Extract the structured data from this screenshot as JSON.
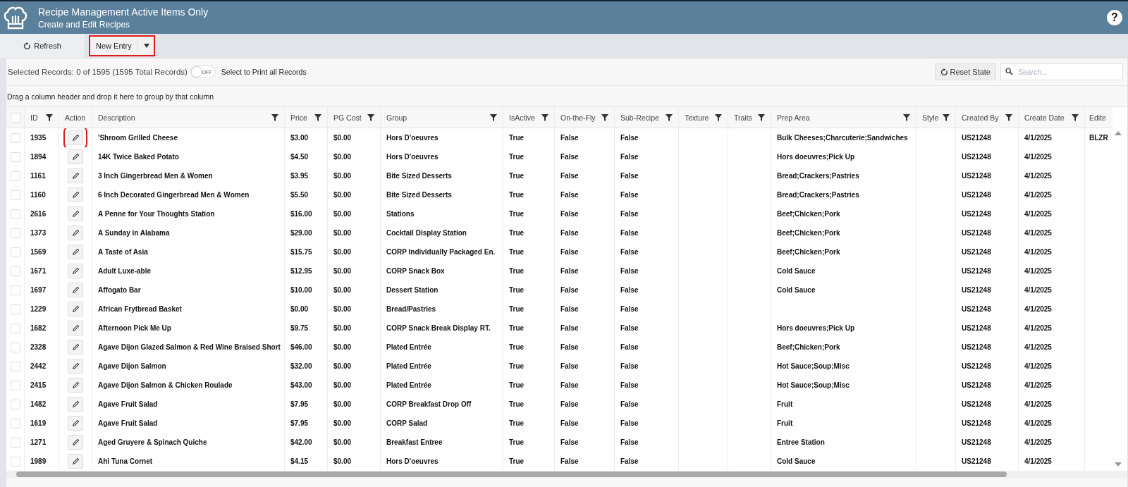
{
  "header": {
    "title": "Recipe Management Active Items Only",
    "subtitle": "Create and Edit Recipes",
    "help": "?"
  },
  "toolbar": {
    "refresh": "Refresh",
    "new_entry": {
      "label": "New Entry",
      "highlighted": true
    }
  },
  "records": {
    "summary": "Selected Records: 0 of 1595 (1595 Total Records)",
    "print_toggle": {
      "on": false,
      "label": "OFF"
    },
    "print_label": "Select to Print all Records",
    "reset": "Reset State",
    "search": {
      "placeholder": "Search..."
    }
  },
  "group_hint": "Drag a column header and drop it here to group by that column",
  "table": {
    "select_all": {
      "checked": false
    },
    "columns": [
      {
        "label": "ID",
        "filter": true
      },
      {
        "label": "Action",
        "filter": false
      },
      {
        "label": "Description",
        "filter": true
      },
      {
        "label": "Price",
        "filter": true
      },
      {
        "label": "PG Cost",
        "filter": true
      },
      {
        "label": "Group",
        "filter": true
      },
      {
        "label": "IsActive",
        "filter": true
      },
      {
        "label": "On-the-Fly",
        "filter": true
      },
      {
        "label": "Sub-Recipe",
        "filter": true
      },
      {
        "label": "Texture",
        "filter": true
      },
      {
        "label": "Traits",
        "filter": true
      },
      {
        "label": "Prep Area",
        "filter": true
      },
      {
        "label": "Style",
        "filter": true
      },
      {
        "label": "Created By",
        "filter": true
      },
      {
        "label": "Create Date",
        "filter": true
      },
      {
        "label": "Edite",
        "filter": false
      }
    ],
    "rows": [
      {
        "checked": false,
        "action_highlighted": true,
        "id": "1935",
        "description": "'Shroom Grilled Cheese",
        "price": "$3.00",
        "pg_cost": "$0.00",
        "group": "Hors D'oeuvres",
        "is_active": "True",
        "on_the_fly": "False",
        "sub_recipe": "False",
        "prep_area": "Bulk Cheeses;Charcuterie;Sandwiches",
        "created_by": "US21248",
        "create_date": "4/1/2025",
        "edited": "BLZR"
      },
      {
        "checked": false,
        "action_highlighted": false,
        "id": "1894",
        "description": "14K Twice Baked Potato",
        "price": "$4.50",
        "pg_cost": "$0.00",
        "group": "Hors D'oeuvres",
        "is_active": "True",
        "on_the_fly": "False",
        "sub_recipe": "False",
        "prep_area": "Hors doeuvres;Pick Up",
        "created_by": "US21248",
        "create_date": "4/1/2025"
      },
      {
        "checked": false,
        "action_highlighted": false,
        "id": "1161",
        "description": "3 Inch Gingerbread Men & Women",
        "price": "$3.95",
        "pg_cost": "$0.00",
        "group": "Bite Sized Desserts",
        "is_active": "True",
        "on_the_fly": "False",
        "sub_recipe": "False",
        "prep_area": "Bread;Crackers;Pastries",
        "created_by": "US21248",
        "create_date": "4/1/2025"
      },
      {
        "checked": false,
        "action_highlighted": false,
        "id": "1160",
        "description": "6 Inch Decorated Gingerbread Men & Women",
        "price": "$5.50",
        "pg_cost": "$0.00",
        "group": "Bite Sized Desserts",
        "is_active": "True",
        "on_the_fly": "False",
        "sub_recipe": "False",
        "prep_area": "Bread;Crackers;Pastries",
        "created_by": "US21248",
        "create_date": "4/1/2025"
      },
      {
        "checked": false,
        "action_highlighted": false,
        "id": "2616",
        "description": "A Penne for Your Thoughts Station",
        "price": "$16.00",
        "pg_cost": "$0.00",
        "group": "Stations",
        "is_active": "True",
        "on_the_fly": "False",
        "sub_recipe": "False",
        "prep_area": "Beef;Chicken;Pork",
        "created_by": "US21248",
        "create_date": "4/1/2025"
      },
      {
        "checked": false,
        "action_highlighted": false,
        "id": "1373",
        "description": "A Sunday in Alabama",
        "price": "$29.00",
        "pg_cost": "$0.00",
        "group": "Cocktail Display Station",
        "is_active": "True",
        "on_the_fly": "False",
        "sub_recipe": "False",
        "prep_area": "Beef;Chicken;Pork",
        "created_by": "US21248",
        "create_date": "4/1/2025"
      },
      {
        "checked": false,
        "action_highlighted": false,
        "id": "1569",
        "description": "A Taste of Asia",
        "price": "$15.75",
        "pg_cost": "$0.00",
        "group": "CORP Individually Packaged En.",
        "is_active": "True",
        "on_the_fly": "False",
        "sub_recipe": "False",
        "prep_area": "Beef;Chicken;Pork",
        "created_by": "US21248",
        "create_date": "4/1/2025"
      },
      {
        "checked": false,
        "action_highlighted": false,
        "id": "1671",
        "description": "Adult Luxe-able",
        "price": "$12.95",
        "pg_cost": "$0.00",
        "group": "CORP Snack Box",
        "is_active": "True",
        "on_the_fly": "False",
        "sub_recipe": "False",
        "prep_area": "Cold Sauce",
        "created_by": "US21248",
        "create_date": "4/1/2025"
      },
      {
        "checked": false,
        "action_highlighted": false,
        "id": "1697",
        "description": "Affogato Bar",
        "price": "$10.00",
        "pg_cost": "$0.00",
        "group": "Dessert Station",
        "is_active": "True",
        "on_the_fly": "False",
        "sub_recipe": "False",
        "prep_area": "Cold Sauce",
        "created_by": "US21248",
        "create_date": "4/1/2025"
      },
      {
        "checked": false,
        "action_highlighted": false,
        "id": "1229",
        "description": "African Frytbread Basket",
        "price": "$0.00",
        "pg_cost": "$0.00",
        "group": "Bread/Pastries",
        "is_active": "True",
        "on_the_fly": "False",
        "sub_recipe": "False",
        "created_by": "US21248",
        "create_date": "4/1/2025"
      },
      {
        "checked": false,
        "action_highlighted": false,
        "id": "1682",
        "description": "Afternoon Pick Me Up",
        "price": "$9.75",
        "pg_cost": "$0.00",
        "group": "CORP Snack Break Display RT.",
        "is_active": "True",
        "on_the_fly": "False",
        "sub_recipe": "False",
        "prep_area": "Hors doeuvres;Pick Up",
        "created_by": "US21248",
        "create_date": "4/1/2025"
      },
      {
        "checked": false,
        "action_highlighted": false,
        "id": "2328",
        "description": "Agave Dijon Glazed Salmon & Red Wine Braised Short",
        "price": "$46.00",
        "pg_cost": "$0.00",
        "group": "Plated Entrée",
        "is_active": "True",
        "on_the_fly": "False",
        "sub_recipe": "False",
        "prep_area": "Beef;Chicken;Pork",
        "created_by": "US21248",
        "create_date": "4/1/2025"
      },
      {
        "checked": false,
        "action_highlighted": false,
        "id": "2442",
        "description": "Agave Dijon Salmon",
        "price": "$32.00",
        "pg_cost": "$0.00",
        "group": "Plated Entrée",
        "is_active": "True",
        "on_the_fly": "False",
        "sub_recipe": "False",
        "prep_area": "Hot Sauce;Soup;Misc",
        "created_by": "US21248",
        "create_date": "4/1/2025"
      },
      {
        "checked": false,
        "action_highlighted": false,
        "id": "2415",
        "description": "Agave Dijon Salmon & Chicken Roulade",
        "price": "$43.00",
        "pg_cost": "$0.00",
        "group": "Plated Entrée",
        "is_active": "True",
        "on_the_fly": "False",
        "sub_recipe": "False",
        "prep_area": "Hot Sauce;Soup;Misc",
        "created_by": "US21248",
        "create_date": "4/1/2025"
      },
      {
        "checked": false,
        "action_highlighted": false,
        "id": "1482",
        "description": "Agave Fruit Salad",
        "price": "$7.95",
        "pg_cost": "$0.00",
        "group": "CORP Breakfast Drop Off",
        "is_active": "True",
        "on_the_fly": "False",
        "sub_recipe": "False",
        "prep_area": "Fruit",
        "created_by": "US21248",
        "create_date": "4/1/2025"
      },
      {
        "checked": false,
        "action_highlighted": false,
        "id": "1619",
        "description": "Agave Fruit Salad",
        "price": "$7.95",
        "pg_cost": "$0.00",
        "group": "CORP Salad",
        "is_active": "True",
        "on_the_fly": "False",
        "sub_recipe": "False",
        "prep_area": "Fruit",
        "created_by": "US21248",
        "create_date": "4/1/2025"
      },
      {
        "checked": false,
        "action_highlighted": false,
        "id": "1271",
        "description": "Aged Gruyere & Spinach Quiche",
        "price": "$42.00",
        "pg_cost": "$0.00",
        "group": "Breakfast Entree",
        "is_active": "True",
        "on_the_fly": "False",
        "sub_recipe": "False",
        "prep_area": "Entree Station",
        "created_by": "US21248",
        "create_date": "4/1/2025"
      },
      {
        "checked": false,
        "action_highlighted": false,
        "id": "1989",
        "description": "Ahi Tuna Cornet",
        "price": "$4.15",
        "pg_cost": "$0.00",
        "group": "Hors D'oeuvres",
        "is_active": "True",
        "on_the_fly": "False",
        "sub_recipe": "False",
        "prep_area": "Cold Sauce",
        "created_by": "US21248",
        "create_date": "4/1/2025"
      }
    ]
  }
}
